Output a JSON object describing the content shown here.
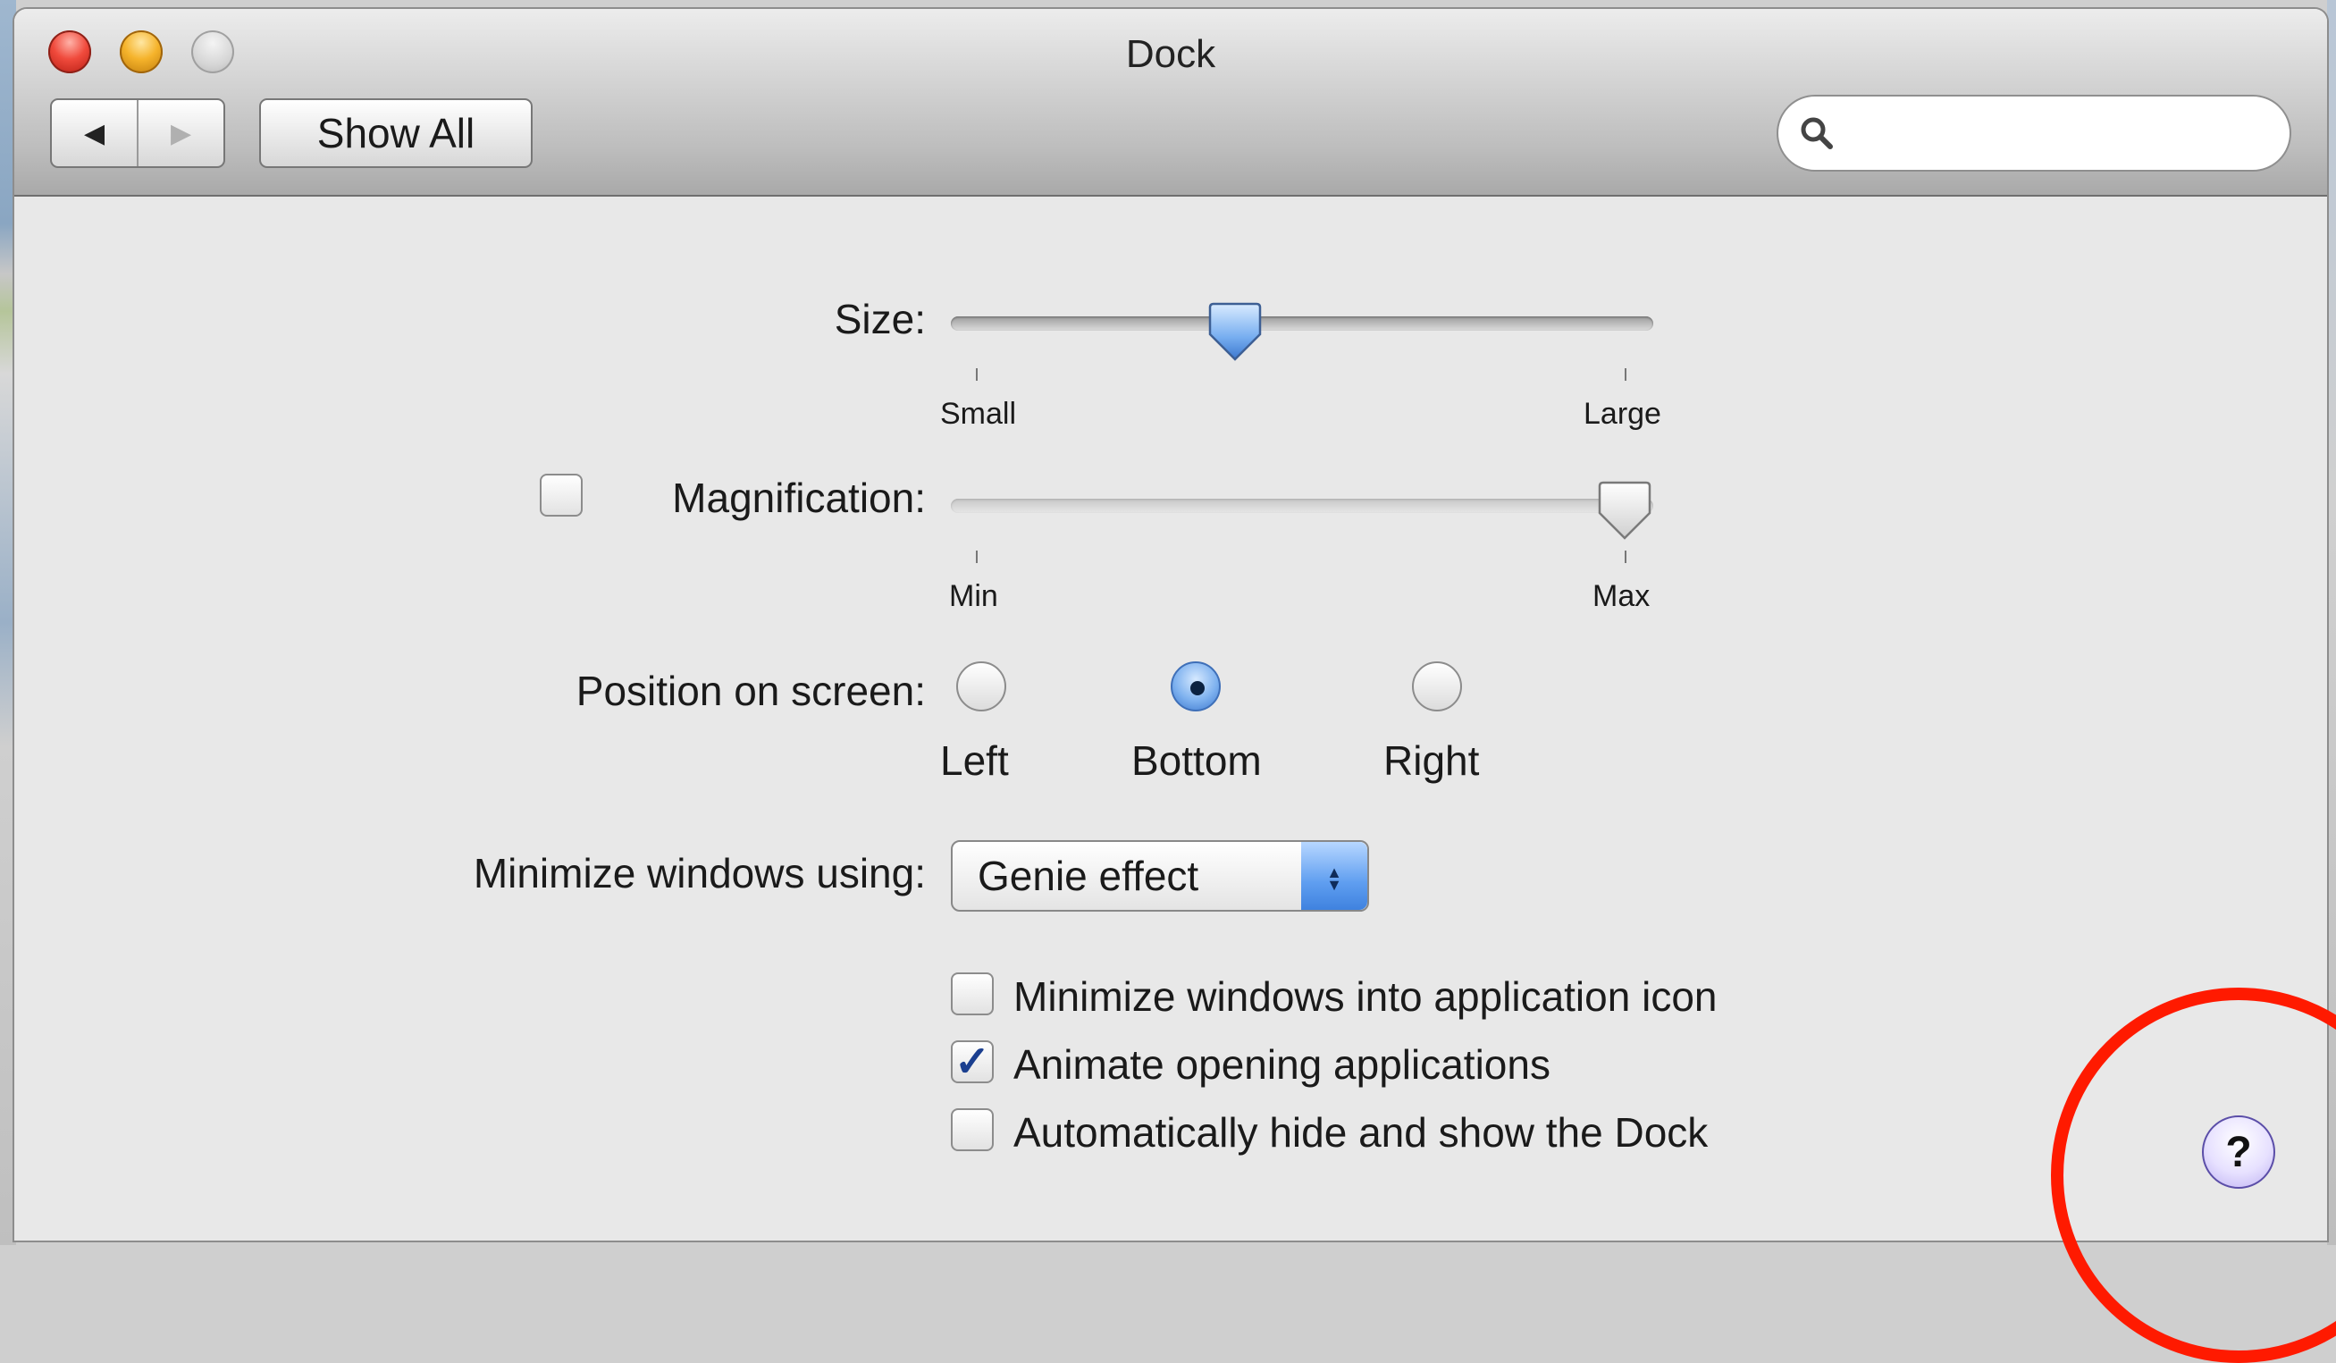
{
  "window": {
    "title": "Dock",
    "nav_back_glyph": "◀",
    "nav_forward_glyph": "▶",
    "show_all_label": "Show All",
    "search": {
      "placeholder": "",
      "value": ""
    }
  },
  "dock": {
    "size": {
      "label": "Size:",
      "min_label": "Small",
      "max_label": "Large",
      "value_fraction": 0.4
    },
    "magnification": {
      "label": "Magnification:",
      "checked": false,
      "min_label": "Min",
      "max_label": "Max",
      "value_fraction": 1.0
    },
    "position": {
      "label": "Position on screen:",
      "options": [
        "Left",
        "Bottom",
        "Right"
      ],
      "selected": "Bottom"
    },
    "minimize_using": {
      "label": "Minimize windows using:",
      "value": "Genie effect",
      "arrows_glyph": "▲▼"
    },
    "options": [
      {
        "label": "Minimize windows into application icon",
        "checked": false
      },
      {
        "label": "Animate opening applications",
        "checked": true
      },
      {
        "label": "Automatically hide and show the Dock",
        "checked": false
      }
    ],
    "help_label": "?"
  },
  "colors": {
    "annotation": "#ff1a00",
    "accent": "#3c78cf"
  },
  "icons": [
    "close-button",
    "minimize-button",
    "zoom-button",
    "search-icon",
    "help-icon"
  ]
}
